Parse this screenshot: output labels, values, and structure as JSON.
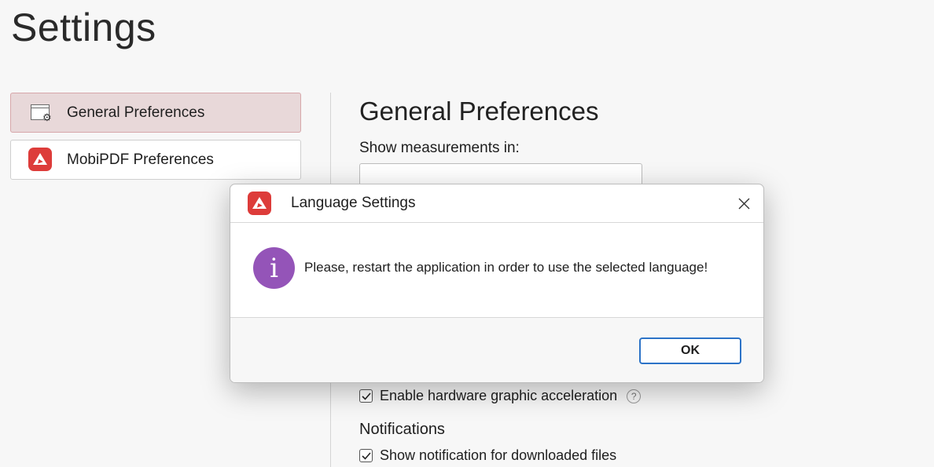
{
  "page": {
    "title": "Settings"
  },
  "sidebar": {
    "items": [
      {
        "label": "General Preferences",
        "icon": "window-gear-icon",
        "active": true
      },
      {
        "label": "MobiPDF Preferences",
        "icon": "mobipdf-logo-icon",
        "active": false
      }
    ]
  },
  "main": {
    "section_title": "General Preferences",
    "measurements_label": "Show measurements in:",
    "hardware_accel": {
      "label": "Enable hardware graphic acceleration",
      "checked": true,
      "help_icon": "help-icon"
    },
    "notifications_heading": "Notifications",
    "downloaded_notification": {
      "label": "Show notification for downloaded files",
      "checked": true
    }
  },
  "dialog": {
    "title": "Language Settings",
    "icon": "mobipdf-logo-icon",
    "message": "Please, restart the application in order to use the selected language!",
    "info_icon": "info-icon",
    "info_glyph": "i",
    "ok_label": "OK",
    "close_icon": "close-icon"
  },
  "colors": {
    "accent": "#2c73c7",
    "brand": "#dd3c3a",
    "info": "#9454b8",
    "active_nav": "#e8d8d9"
  }
}
